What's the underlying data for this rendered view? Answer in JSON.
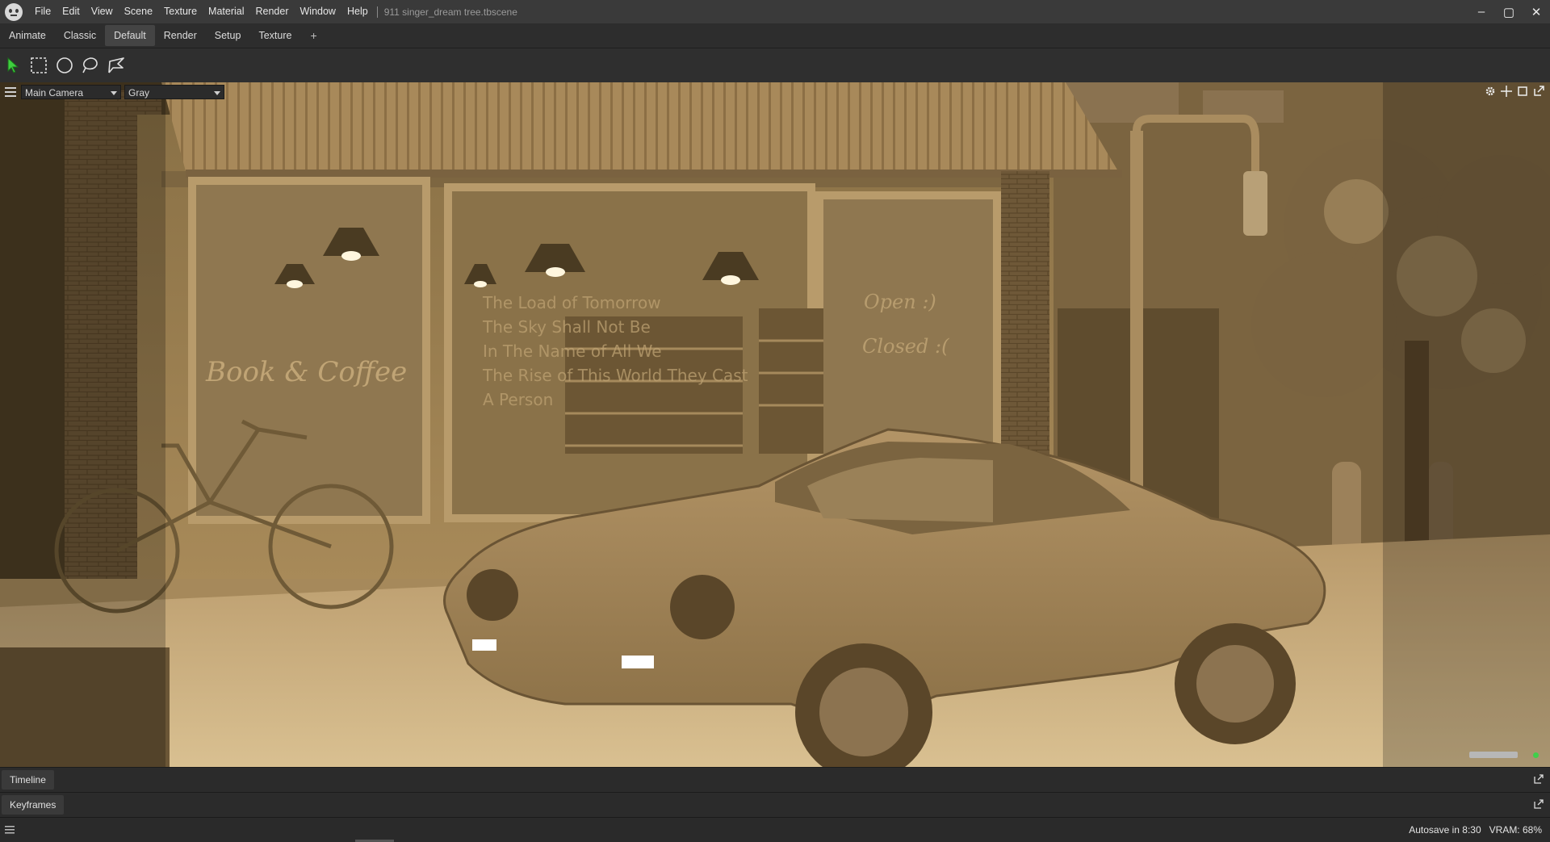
{
  "titlebar": {
    "menu": [
      "File",
      "Edit",
      "View",
      "Scene",
      "Texture",
      "Material",
      "Render",
      "Window",
      "Help"
    ],
    "document_title": "911 singer_dream tree.tbscene",
    "controls": {
      "minimize": "–",
      "restore": "▢",
      "close": "✕"
    }
  },
  "workspace_tabs": {
    "items": [
      "Animate",
      "Classic",
      "Default",
      "Render",
      "Setup",
      "Texture"
    ],
    "active": "Default",
    "add_label": "+"
  },
  "toolbar": {
    "tools": [
      "select-arrow-icon",
      "rectangle-select-icon",
      "circle-select-icon",
      "lasso-select-icon",
      "polygon-lasso-icon"
    ]
  },
  "viewport": {
    "camera": "Main Camera",
    "shading": "Gray",
    "scene_text": {
      "shop_sign": "Book & Coffee",
      "window_lines": [
        "The Load of Tomorrow",
        "The Sky Shall Not Be",
        "In The Name of All We",
        "The Rise of This World They Cast",
        "A Person"
      ],
      "door_sign_open": "Open :)",
      "door_sign_closed": "Closed :("
    },
    "colors": {
      "tint": "#b79a63",
      "shade": "#5b4a2c"
    },
    "icons": [
      "gear-icon",
      "move-icon",
      "maximize-icon",
      "popout-icon"
    ]
  },
  "panels": {
    "timeline": "Timeline",
    "keyframes": "Keyframes"
  },
  "status": {
    "autosave": "Autosave in 8:30",
    "vram": "VRAM: 68%"
  }
}
